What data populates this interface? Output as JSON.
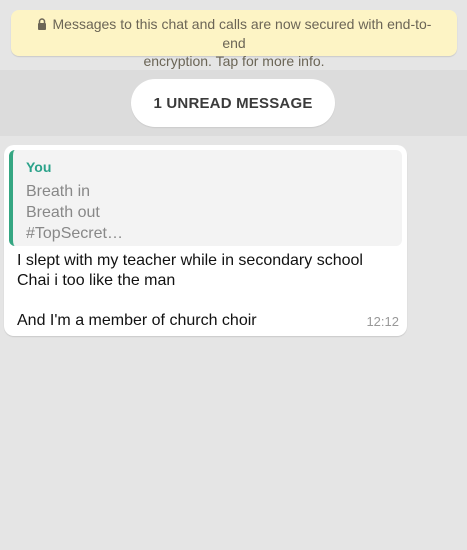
{
  "encryption_notice": {
    "icon": "lock-icon",
    "line1": "Messages to this chat and calls are now secured with end-to-end",
    "line2": "encryption. Tap for more info."
  },
  "unread_indicator": {
    "label": "1 UNREAD MESSAGE"
  },
  "message": {
    "quoted": {
      "author": "You",
      "lines": [
        "Breath in",
        "Breath out",
        "#TopSecret…"
      ]
    },
    "lines": [
      "I slept with my teacher while in secondary school",
      "Chai i too like the man",
      "",
      "And I'm a member of church choir"
    ],
    "time": "12:12"
  },
  "colors": {
    "background": "#e5e5e5",
    "banner": "#fdf4c5",
    "quote_accent": "#35a682",
    "author": "#2ba28a"
  }
}
